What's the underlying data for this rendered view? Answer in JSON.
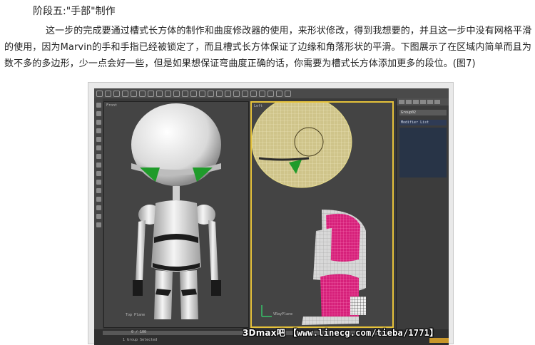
{
  "heading": "阶段五:\"手部\"制作",
  "paragraph": "这一步的完成要通过槽式长方体的制作和曲度修改器的使用，来形状修改，得到我想要的，并且这一步中没有网格平滑的使用，因为Marvin的手和手指已经被锁定了，而且槽式长方体保证了边缘和角落形状的平滑。下图展示了在区域内简单而且为数不多的多边形，少一点会好一些，但是如果想保证弯曲度正确的话，你需要为槽式长方体添加更多的段位。(图7)",
  "figure": {
    "viewport_front_label": "Front",
    "viewport_left_label": "Left",
    "viewport_front_footer": "Top Plane",
    "viewport_left_footer": "VRayPlane",
    "panel_object_name": "Group02",
    "panel_modifier_list": "Modifier List",
    "timeline_frame": "0 / 100",
    "status_text": "1 Group Selected",
    "colors": {
      "viewport_bg": "#444444",
      "active_border": "#e6c23a",
      "body_white": "#f2f2f2",
      "eye_green": "#1f9b2a",
      "wire_yellow": "#e8dd8a",
      "wire_pink": "#d6207a"
    }
  },
  "watermark": {
    "brand": "3Dmax吧",
    "site": "【www.linecg.com/tieba/1771】"
  }
}
